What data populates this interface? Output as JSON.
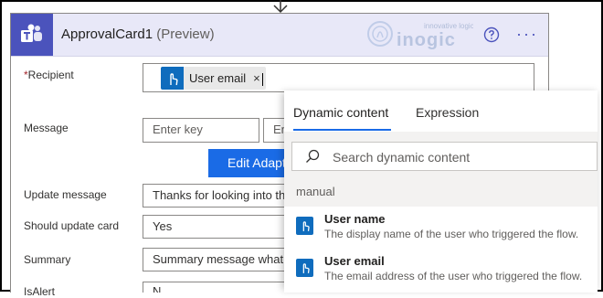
{
  "card": {
    "title": "ApprovalCard1",
    "preview": "(Preview)",
    "watermark_top": "innovative logic",
    "watermark_brand": "inogic",
    "help_icon": "question-circle-icon",
    "more_icon": "ellipsis-icon",
    "more_glyph": "···"
  },
  "fields": {
    "recipient": {
      "required_mark": "*",
      "label": "Recipient",
      "token": "User email",
      "token_close": "×"
    },
    "message": {
      "label": "Message",
      "key_placeholder": "Enter key",
      "value_placeholder_visible": "En"
    },
    "edit_button": "Edit Adapt",
    "update_message": {
      "label": "Update message",
      "value": "Thanks for looking into this"
    },
    "should_update_card": {
      "label": "Should update card",
      "value": "Yes"
    },
    "summary": {
      "label": "Summary",
      "value": "Summary message what do"
    },
    "is_alert": {
      "label": "IsAlert",
      "value": "N"
    }
  },
  "popup": {
    "tabs": [
      "Dynamic content",
      "Expression"
    ],
    "active_tab": "Dynamic content",
    "search_placeholder": "Search dynamic content",
    "section": "manual",
    "items": [
      {
        "name": "User name",
        "description": "The display name of the user who triggered the flow."
      },
      {
        "name": "User email",
        "description": "The email address of the user who triggered the flow."
      }
    ]
  },
  "colors": {
    "teams_brand": "#4b53bc",
    "accent_blue": "#1a6be6",
    "required": "#a4262c"
  }
}
